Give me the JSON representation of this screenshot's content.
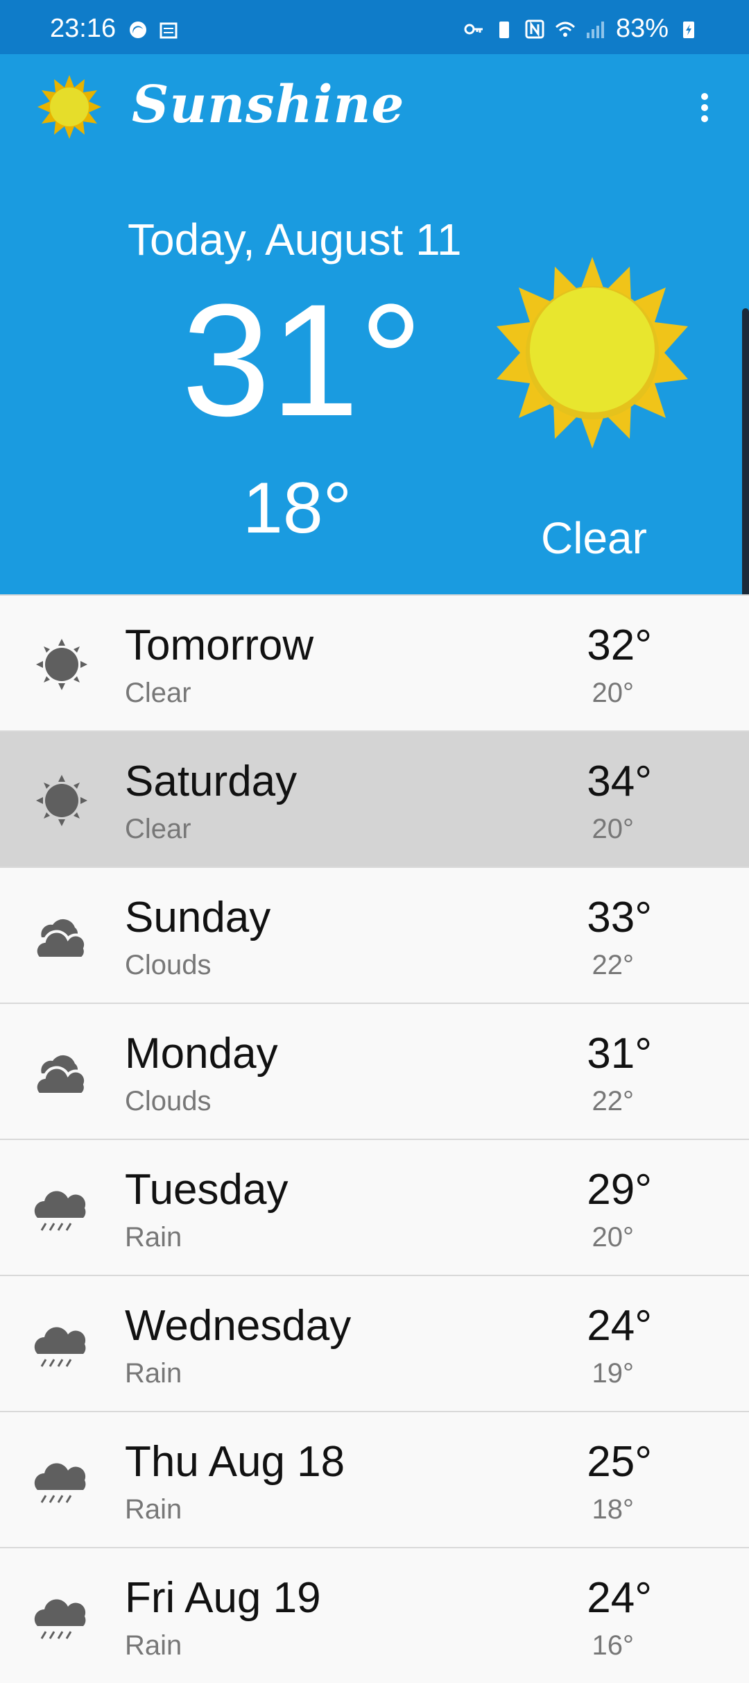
{
  "status_bar": {
    "time": "23:16",
    "battery": "83%",
    "icons": [
      "weather-icon",
      "sd-card-icon",
      "vpn-key-icon",
      "battery-saver-icon",
      "nfc-icon",
      "wifi-icon",
      "signal-icon",
      "battery-charging-icon"
    ]
  },
  "app": {
    "title": "Sunshine",
    "logo_icon": "sun-icon",
    "menu_icon": "overflow-menu-icon"
  },
  "today": {
    "date": "Today, August 11",
    "high": "31°",
    "low": "18°",
    "condition": "Clear",
    "icon": "sun-icon"
  },
  "forecast": [
    {
      "day": "Tomorrow",
      "condition": "Clear",
      "high": "32°",
      "low": "20°",
      "icon": "clear-icon"
    },
    {
      "day": "Saturday",
      "condition": "Clear",
      "high": "34°",
      "low": "20°",
      "icon": "clear-icon",
      "selected": true
    },
    {
      "day": "Sunday",
      "condition": "Clouds",
      "high": "33°",
      "low": "22°",
      "icon": "clouds-icon"
    },
    {
      "day": "Monday",
      "condition": "Clouds",
      "high": "31°",
      "low": "22°",
      "icon": "clouds-icon"
    },
    {
      "day": "Tuesday",
      "condition": "Rain",
      "high": "29°",
      "low": "20°",
      "icon": "rain-icon"
    },
    {
      "day": "Wednesday",
      "condition": "Rain",
      "high": "24°",
      "low": "19°",
      "icon": "rain-icon"
    },
    {
      "day": "Thu Aug 18",
      "condition": "Rain",
      "high": "25°",
      "low": "18°",
      "icon": "rain-icon"
    },
    {
      "day": "Fri Aug 19",
      "condition": "Rain",
      "high": "24°",
      "low": "16°",
      "icon": "rain-icon"
    }
  ],
  "colors": {
    "primary": "#1a9be0",
    "status_bar": "#0f7cc9",
    "selected_row": "#d4d4d4",
    "icon_gray": "#5f5f5f"
  }
}
